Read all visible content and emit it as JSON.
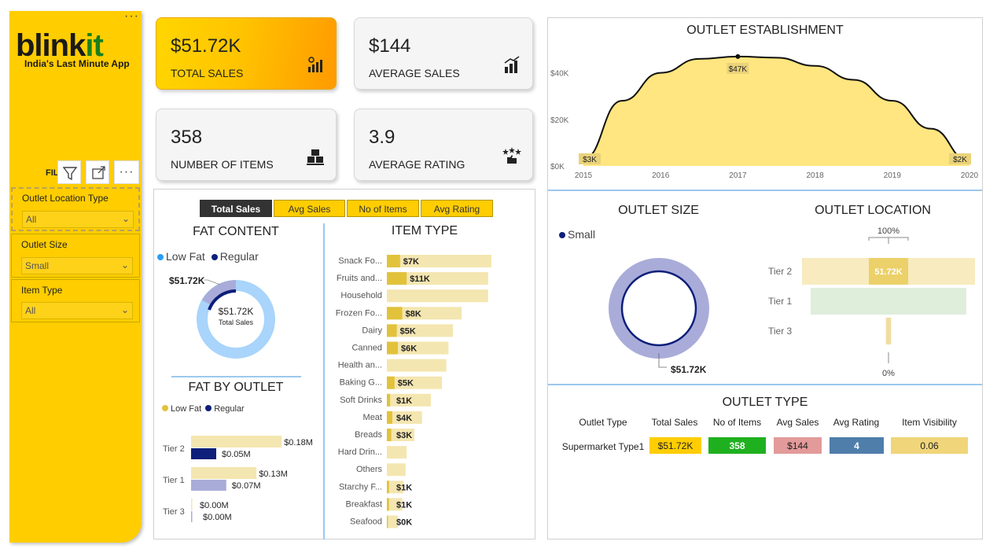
{
  "sidebar": {
    "logo_main": "blink",
    "logo_accent": "it",
    "tagline": "India's Last Minute App",
    "filters_heading": "FILTERS PANE",
    "more": "···",
    "filters": [
      {
        "label": "Outlet Location Type",
        "value": "All"
      },
      {
        "label": "Outlet Size",
        "value": "Small"
      },
      {
        "label": "Item Type",
        "value": "All"
      }
    ]
  },
  "kpis": [
    {
      "value": "$51.72K",
      "label": "TOTAL SALES",
      "icon": "sales-chart-icon"
    },
    {
      "value": "$144",
      "label": "AVERAGE SALES",
      "icon": "growth-icon"
    },
    {
      "value": "358",
      "label": "NUMBER OF ITEMS",
      "icon": "boxes-icon"
    },
    {
      "value": "3.9",
      "label": "AVERAGE RATING",
      "icon": "rating-icon"
    }
  ],
  "tabs": [
    "Total Sales",
    "Avg Sales",
    "No of Items",
    "Avg Rating"
  ],
  "colors": {
    "accent": "#ffcd00",
    "dark_blue": "#0d1f7a",
    "light_blue": "#a9d4fb",
    "lavender": "#a9acd9",
    "bar_dark": "#e2c23b",
    "bar_light": "#f4e6b0"
  },
  "fat_content": {
    "title": "FAT CONTENT",
    "legend": [
      "Low Fat",
      "Regular"
    ],
    "outer_label": "$51.72K",
    "center_value": "$51.72K",
    "center_label": "Total Sales"
  },
  "item_type": {
    "title": "ITEM TYPE",
    "rows": [
      {
        "name": "Snack Fo...",
        "label": "$7K",
        "dark": 0.12,
        "light": 0.95
      },
      {
        "name": "Fruits and...",
        "label": "$11K",
        "dark": 0.18,
        "light": 0.92
      },
      {
        "name": "Household",
        "label": "",
        "dark": 0.0,
        "light": 0.92
      },
      {
        "name": "Frozen Fo...",
        "label": "$8K",
        "dark": 0.14,
        "light": 0.68
      },
      {
        "name": "Dairy",
        "label": "$5K",
        "dark": 0.09,
        "light": 0.6
      },
      {
        "name": "Canned",
        "label": "$6K",
        "dark": 0.1,
        "light": 0.56
      },
      {
        "name": "Health an...",
        "label": "",
        "dark": 0.0,
        "light": 0.54
      },
      {
        "name": "Baking G...",
        "label": "$5K",
        "dark": 0.07,
        "light": 0.5
      },
      {
        "name": "Soft Drinks",
        "label": "$1K",
        "dark": 0.03,
        "light": 0.4
      },
      {
        "name": "Meat",
        "label": "$4K",
        "dark": 0.05,
        "light": 0.32
      },
      {
        "name": "Breads",
        "label": "$3K",
        "dark": 0.04,
        "light": 0.25
      },
      {
        "name": "Hard Drin...",
        "label": "",
        "dark": 0.0,
        "light": 0.18
      },
      {
        "name": "Others",
        "label": "",
        "dark": 0.0,
        "light": 0.17
      },
      {
        "name": "Starchy F...",
        "label": "$1K",
        "dark": 0.02,
        "light": 0.15
      },
      {
        "name": "Breakfast",
        "label": "$1K",
        "dark": 0.02,
        "light": 0.14
      },
      {
        "name": "Seafood",
        "label": "$0K",
        "dark": 0.01,
        "light": 0.1
      }
    ]
  },
  "fat_by_outlet": {
    "title": "FAT BY OUTLET",
    "legend": [
      "Low Fat",
      "Regular"
    ],
    "rows": [
      {
        "name": "Tier 2",
        "low": 0.18,
        "low_label": "$0.18M",
        "reg": 0.05,
        "reg_label": "$0.05M"
      },
      {
        "name": "Tier 1",
        "low": 0.13,
        "low_label": "$0.13M",
        "reg": 0.07,
        "reg_label": "$0.07M"
      },
      {
        "name": "Tier 3",
        "low": 0.0,
        "low_label": "$0.00M",
        "reg": 0.0,
        "reg_label": "$0.00M"
      }
    ]
  },
  "chart_data": {
    "type": "area",
    "title": "OUTLET ESTABLISHMENT",
    "x": [
      2015,
      2016,
      2017,
      2018,
      2019,
      2020
    ],
    "y_ticks": [
      "$0K",
      "$20K",
      "$40K"
    ],
    "ylim": [
      0,
      50
    ],
    "peak": {
      "x": 2017,
      "y": 47,
      "label": "$47K"
    },
    "start": {
      "x": 2015,
      "y": 3,
      "label": "$3K"
    },
    "end": {
      "x": 2020,
      "y": 2,
      "label": "$2K"
    },
    "curve": [
      {
        "x": 2015,
        "y": 3
      },
      {
        "x": 2015.5,
        "y": 28
      },
      {
        "x": 2016,
        "y": 40
      },
      {
        "x": 2016.5,
        "y": 46
      },
      {
        "x": 2017,
        "y": 47
      },
      {
        "x": 2017.5,
        "y": 46.5
      },
      {
        "x": 2018,
        "y": 43
      },
      {
        "x": 2018.5,
        "y": 37
      },
      {
        "x": 2019,
        "y": 28
      },
      {
        "x": 2019.5,
        "y": 16
      },
      {
        "x": 2020,
        "y": 2
      }
    ]
  },
  "outlet_size": {
    "title": "OUTLET SIZE",
    "legend": "Small",
    "label": "$51.72K"
  },
  "outlet_location": {
    "title": "OUTLET LOCATION",
    "top_label": "100%",
    "bottom_label": "0%",
    "bar_label": "51.72K",
    "rows": [
      {
        "name": "Tier 2",
        "share": 1.0
      },
      {
        "name": "Tier 1",
        "share": 0.9
      },
      {
        "name": "Tier 3",
        "share": 0.03
      }
    ]
  },
  "outlet_type": {
    "title": "OUTLET TYPE",
    "headers": [
      "Outlet Type",
      "Total Sales",
      "No of Items",
      "Avg Sales",
      "Avg Rating",
      "Item Visibility"
    ],
    "row": [
      "Supermarket Type1",
      "$51.72K",
      "358",
      "$144",
      "4",
      "0.06"
    ]
  }
}
